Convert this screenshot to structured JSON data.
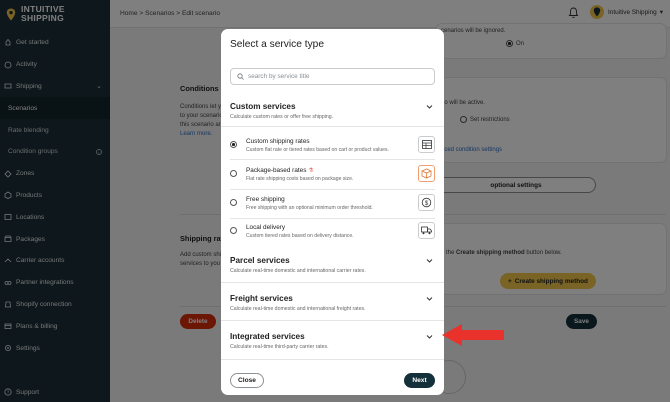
{
  "brand": {
    "name_line1": "INTUITIVE",
    "name_line2": "SHIPPING",
    "accent": "#f2c94c",
    "sidebar_bg": "#1d2f36"
  },
  "sidebar": {
    "items": [
      {
        "label": "Get started",
        "icon": "rocket-icon"
      },
      {
        "label": "Activity",
        "icon": "activity-icon"
      },
      {
        "label": "Shipping",
        "icon": "shipping-icon",
        "expanded": true
      },
      {
        "label": "Scenarios",
        "sub": true,
        "active": true
      },
      {
        "label": "Rate blending",
        "sub": true
      },
      {
        "label": "Condition groups",
        "sub": true
      },
      {
        "label": "Zones",
        "icon": "zones-icon"
      },
      {
        "label": "Products",
        "icon": "products-icon"
      },
      {
        "label": "Locations",
        "icon": "locations-icon"
      },
      {
        "label": "Packages",
        "icon": "packages-icon"
      },
      {
        "label": "Carrier accounts",
        "icon": "carrier-icon"
      },
      {
        "label": "Partner integrations",
        "icon": "partner-icon"
      },
      {
        "label": "Shopify connection",
        "icon": "shopify-icon"
      },
      {
        "label": "Plans & billing",
        "icon": "billing-icon"
      },
      {
        "label": "Settings",
        "icon": "settings-icon"
      }
    ],
    "support": "Support"
  },
  "topbar": {
    "breadcrumb": "Home > Scenarios > Edit scenario",
    "account_name": "Intuitive Shipping",
    "account_chevron": "▾"
  },
  "background": {
    "ignored_text": "cenarios will be ignored.",
    "on_label": "On",
    "conditions_title": "Conditions",
    "conditions_desc_1": "Conditions let y",
    "conditions_desc_2": "to your scenario",
    "conditions_desc_3": "this scenario ar",
    "learn_more": "Learn more.",
    "will_be_active": "rio will be active.",
    "set_restrictions": "Set restrictions",
    "advanced_link": "nced condition settings",
    "optional_settings": "optional settings",
    "shipping_rates_title": "Shipping rat",
    "shipping_desc_1": "Add custom shi",
    "shipping_desc_2": "services to you",
    "create_hint_prefix": "g the ",
    "create_hint_bold": "Create shipping method",
    "create_hint_suffix": " button below.",
    "create_button": "Create shipping method",
    "delete_button": "Delete",
    "save_button": "Save"
  },
  "modal": {
    "title": "Select a service type",
    "search_placeholder": "search by service title",
    "sections": {
      "custom": {
        "title": "Custom services",
        "desc": "Calculate custom rates or offer free shipping."
      },
      "parcel": {
        "title": "Parcel services",
        "desc": "Calculate real-time domestic and international carrier rates."
      },
      "freight": {
        "title": "Freight services",
        "desc": "Calculate real-time domestic and international freight rates."
      },
      "integrated": {
        "title": "Integrated services",
        "desc": "Calculate real-time third-party carrier rates."
      }
    },
    "options": [
      {
        "title": "Custom shipping rates",
        "desc": "Custom flat rate or tiered rates based on cart or product values.",
        "selected": true,
        "icon": "table-icon"
      },
      {
        "title": "Package-based rates",
        "desc": "Flat rate shipping costs based on package size.",
        "selected": false,
        "icon": "package-icon"
      },
      {
        "title": "Free shipping",
        "desc": "Free shipping with an optional minimum order threshold.",
        "selected": false,
        "icon": "dollar-icon"
      },
      {
        "title": "Local delivery",
        "desc": "Custom tiered rates based on delivery distance.",
        "selected": false,
        "icon": "truck-icon"
      }
    ],
    "close_button": "Close",
    "next_button": "Next"
  },
  "annotation_color": "#e8322b"
}
